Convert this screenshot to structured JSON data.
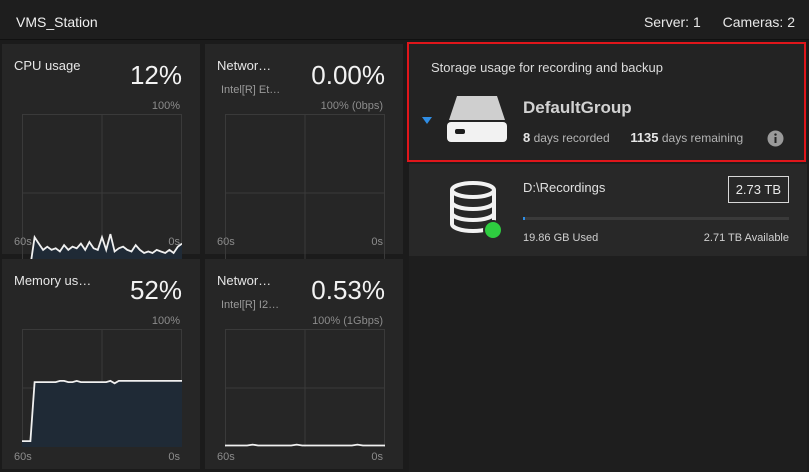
{
  "header": {
    "title": "VMS_Station",
    "server": "Server: 1",
    "cameras": "Cameras: 2"
  },
  "panels": [
    {
      "id": "cpu",
      "label": "CPU usage",
      "sublabel": "",
      "value": "12%",
      "max": "100%",
      "time_start": "60s",
      "time_end": "0s",
      "series": [
        5,
        6,
        4,
        22,
        18,
        14,
        16,
        14,
        15,
        13,
        17,
        14,
        16,
        15,
        18,
        14,
        19,
        15,
        14,
        22,
        14,
        24,
        13,
        15,
        16,
        14,
        13,
        17,
        14,
        12,
        13,
        12,
        14,
        13,
        12,
        14,
        12,
        16,
        18
      ],
      "filled": true
    },
    {
      "id": "net1",
      "label": "Networ…",
      "sublabel": "Intel[R] Et…",
      "value": "0.00%",
      "max": "100% (0bps)",
      "time_start": "60s",
      "time_end": "0s",
      "series": [
        0,
        0,
        0,
        0,
        0,
        0,
        0,
        0,
        0,
        0,
        0,
        0,
        0,
        0,
        0,
        0,
        0,
        0,
        0,
        0
      ],
      "filled": false
    },
    {
      "id": "mem",
      "label": "Memory us…",
      "sublabel": "",
      "value": "52%",
      "max": "100%",
      "time_start": "60s",
      "time_end": "0s",
      "series": [
        5,
        5,
        5,
        55,
        55,
        55,
        55,
        55,
        55,
        56,
        56,
        55,
        55,
        56,
        55,
        55,
        55,
        55,
        55,
        55,
        55,
        56,
        54,
        56,
        56,
        56,
        56,
        56,
        56,
        56,
        56,
        56,
        56,
        56,
        56,
        56,
        56,
        56,
        56
      ],
      "filled": true
    },
    {
      "id": "net2",
      "label": "Networ…",
      "sublabel": "Intel[R] I2…",
      "value": "0.53%",
      "max": "100% (1Gbps)",
      "time_start": "60s",
      "time_end": "0s",
      "series": [
        1,
        1,
        1,
        1,
        1,
        2,
        1,
        1,
        1,
        1,
        1,
        1,
        1,
        2,
        1,
        1,
        1,
        1,
        1,
        1,
        1,
        1,
        1,
        1,
        2,
        1,
        1,
        1,
        1,
        1
      ],
      "filled": false
    }
  ],
  "storage": {
    "title": "Storage usage for recording and backup",
    "group_name": "DefaultGroup",
    "days_recorded_value": "8",
    "days_recorded_label": "days recorded",
    "days_remaining_value": "1135",
    "days_remaining_label": "days remaining",
    "recording": {
      "path": "D:\\Recordings",
      "capacity": "2.73 TB",
      "used": "19.86 GB Used",
      "available": "2.71 TB Available",
      "used_fraction": 0.007
    }
  },
  "colors": {
    "accent": "#2f8de4",
    "highlight": "#e0161b",
    "status_ok": "#2ecc40",
    "chart_fill": "#1f2a36"
  },
  "icons": {
    "arrow": "caret-down-icon",
    "drive": "hard-drive-icon",
    "info": "info-icon",
    "db": "database-icon"
  }
}
